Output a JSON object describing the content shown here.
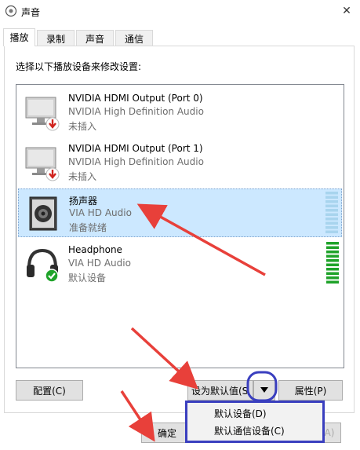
{
  "window": {
    "title": "声音",
    "close_glyph": "✕"
  },
  "tabs": [
    {
      "label": "播放",
      "active": true
    },
    {
      "label": "录制",
      "active": false
    },
    {
      "label": "声音",
      "active": false
    },
    {
      "label": "通信",
      "active": false
    }
  ],
  "instruction": "选择以下播放设备来修改设置:",
  "devices": [
    {
      "name": "NVIDIA HDMI Output (Port 0)",
      "driver": "NVIDIA High Definition Audio",
      "status": "未插入",
      "icon": "monitor-icon"
    },
    {
      "name": "NVIDIA HDMI Output (Port 1)",
      "driver": "NVIDIA High Definition Audio",
      "status": "未插入",
      "icon": "monitor-icon"
    },
    {
      "name": "扬声器",
      "driver": "VIA HD Audio",
      "status": "准备就绪",
      "icon": "speaker-icon",
      "selected": true
    },
    {
      "name": "Headphone",
      "driver": "VIA HD Audio",
      "status": "默认设备",
      "icon": "headphone-icon"
    }
  ],
  "buttons": {
    "configure": "配置(C)",
    "set_default": "设为默认值(S",
    "properties": "属性(P)",
    "ok": "确定",
    "apply_partial": "A)"
  },
  "dropdown": {
    "items": [
      "默认设备(D)",
      "默认通信设备(C)"
    ]
  },
  "colors": {
    "selection": "#cce8ff",
    "meter_active": "#1fa32a",
    "meter_idle": "#a8d4ee",
    "annotation_arrow": "#e8403a",
    "annotation_circle": "#3a3fbf"
  }
}
